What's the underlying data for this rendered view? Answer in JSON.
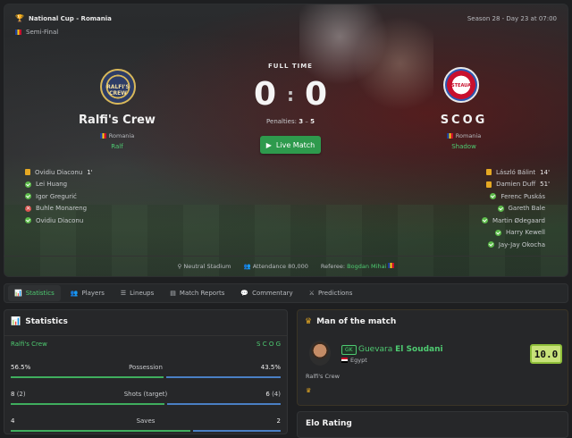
{
  "match": {
    "competition": "National Cup - Romania",
    "stage": "Semi-Final",
    "season_info": "Season 28 - Day 23 at 07:00",
    "status": "FULL TIME",
    "home_score": "0",
    "away_score": "0",
    "penalties_label": "Penalties:",
    "penalties_home": "3",
    "penalties_sep": "–",
    "penalties_away": "5",
    "live_button": "Live Match"
  },
  "home": {
    "name": "Ralfi's Crew",
    "country": "Romania",
    "short": "Ralf",
    "crest_text": "RALFI'S CREW",
    "events": [
      {
        "type": "card",
        "text": "Ovidiu Diaconu",
        "minute": "1'"
      },
      {
        "type": "in",
        "text": "Lei Huang",
        "minute": ""
      },
      {
        "type": "in",
        "text": "Igor Gregurić",
        "minute": ""
      },
      {
        "type": "out",
        "text": "Buhle Monareng",
        "minute": ""
      },
      {
        "type": "in",
        "text": "Ovidiu Diaconu",
        "minute": ""
      }
    ]
  },
  "away": {
    "name": "SCOG",
    "country": "Romania",
    "short": "Shadow",
    "crest_text": "STEAUA",
    "events": [
      {
        "type": "card",
        "text": "László Bálint",
        "minute": "14'"
      },
      {
        "type": "card",
        "text": "Damien Duff",
        "minute": "51'"
      },
      {
        "type": "in",
        "text": "Ferenc Puskás",
        "minute": ""
      },
      {
        "type": "in",
        "text": "Gareth Bale",
        "minute": ""
      },
      {
        "type": "in",
        "text": "Martin Ødegaard",
        "minute": ""
      },
      {
        "type": "in",
        "text": "Harry Kewell",
        "minute": ""
      },
      {
        "type": "in",
        "text": "Jay-Jay Okocha",
        "minute": ""
      }
    ]
  },
  "info": {
    "stadium": "Neutral Stadium",
    "attendance": "Attendance 80,000",
    "referee_label": "Referee:",
    "referee": "Bogdan Mihai"
  },
  "tabs": [
    {
      "label": "Statistics",
      "icon": "chart-icon",
      "active": true
    },
    {
      "label": "Players",
      "icon": "users-icon",
      "active": false
    },
    {
      "label": "Lineups",
      "icon": "list-icon",
      "active": false
    },
    {
      "label": "Match Reports",
      "icon": "report-icon",
      "active": false
    },
    {
      "label": "Commentary",
      "icon": "comment-icon",
      "active": false
    },
    {
      "label": "Predictions",
      "icon": "prediction-icon",
      "active": false
    }
  ],
  "stats": {
    "title": "Statistics",
    "home_team": "Ralfi's Crew",
    "away_team": "S C O G",
    "rows": [
      {
        "label": "Possession",
        "home": "56.5%",
        "home_extra": "",
        "away": "43.5%",
        "away_extra": "",
        "home_pct": 0.565
      },
      {
        "label": "Shots (target)",
        "home": "8",
        "home_extra": "(2)",
        "away": "6",
        "away_extra": "(4)",
        "home_pct": 0.57
      },
      {
        "label": "Saves",
        "home": "4",
        "home_extra": "",
        "away": "2",
        "away_extra": "",
        "home_pct": 0.667
      }
    ]
  },
  "motm": {
    "title": "Man of the match",
    "position": "GK",
    "first_name": "Guevara",
    "last_name": "El Soudani",
    "country": "Egypt",
    "team": "Ralfi's Crew",
    "rating": "10.0"
  },
  "elo": {
    "title": "Elo Rating"
  },
  "colors": {
    "accent": "#4ecb71",
    "gold": "#e5a823",
    "home_bar": "#3fae5e",
    "away_bar": "#4a7fc4"
  }
}
